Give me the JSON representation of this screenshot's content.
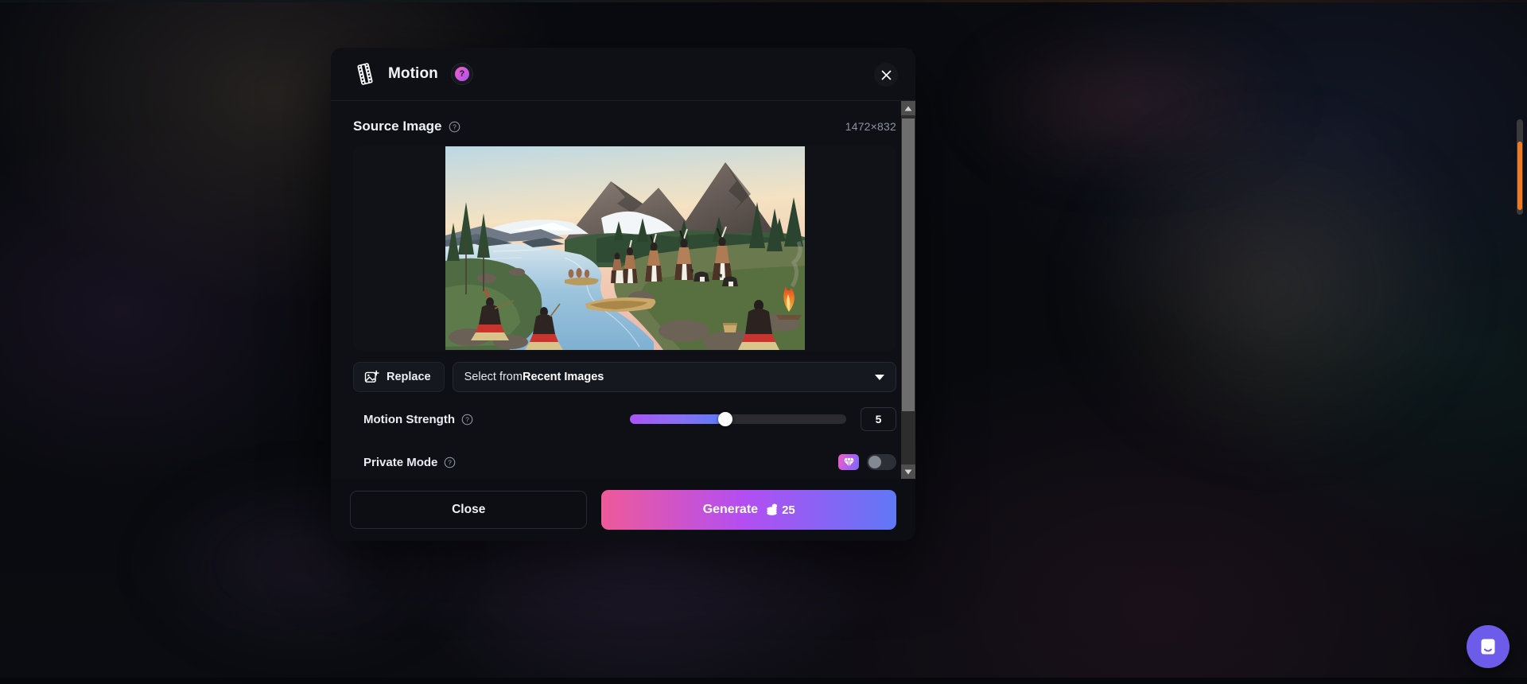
{
  "header": {
    "title": "Motion",
    "icon": "film-strip-icon",
    "help_badge": "?",
    "close_icon": "close-icon"
  },
  "source_section": {
    "title": "Source Image",
    "help_icon": "help-circle-icon",
    "dimensions": "1472×832",
    "preview_alt": "indigenous village scene by river with mountains"
  },
  "controls": {
    "replace_label": "Replace",
    "replace_icon": "image-plus-icon",
    "select_prefix": "Select from ",
    "select_value": "Recent Images",
    "caret_icon": "chevron-down-icon"
  },
  "motion_strength": {
    "label": "Motion Strength",
    "help_icon": "help-circle-icon",
    "value": "5",
    "min": 1,
    "max": 10,
    "fill_percent": 44
  },
  "private_mode": {
    "label": "Private Mode",
    "help_icon": "help-circle-icon",
    "premium_icon": "diamond-icon",
    "enabled": false
  },
  "footer": {
    "close_label": "Close",
    "generate_label": "Generate",
    "token_icon": "coin-stack-icon",
    "cost": "25"
  },
  "scrollbar": {
    "up_icon": "scroll-up-arrow-icon",
    "down_icon": "scroll-down-arrow-icon"
  },
  "chat_widget": {
    "icon": "intercom-chat-icon"
  },
  "colors": {
    "accent_pink": "#f04e9e",
    "accent_purple": "#a855f7",
    "accent_blue": "#5b7cfa",
    "modal_bg": "#0e1015",
    "panel_bg": "#15181e"
  }
}
